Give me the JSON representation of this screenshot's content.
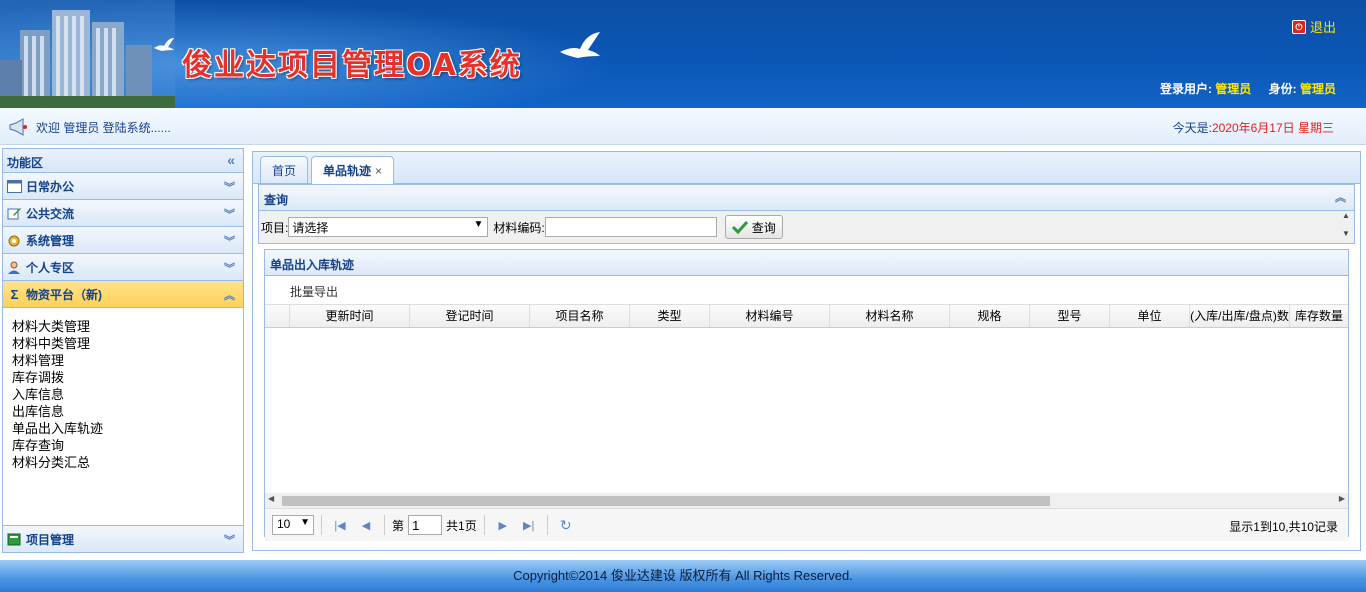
{
  "header": {
    "title": "俊业达项目管理OA系统",
    "logout_label": "退出",
    "user_label": "登录用户:",
    "user_value": "管理员",
    "role_label": "身份:",
    "role_value": "管理员"
  },
  "welcome": {
    "message": "欢迎 管理员 登陆系统......",
    "today_label": "今天是:",
    "date": "2020年6月17日 星期三"
  },
  "sidebar": {
    "title": "功能区",
    "sections": [
      {
        "label": "日常办公",
        "icon": "calendar-icon"
      },
      {
        "label": "公共交流",
        "icon": "edit-icon"
      },
      {
        "label": "系统管理",
        "icon": "gear-icon"
      },
      {
        "label": "个人专区",
        "icon": "user-icon"
      },
      {
        "label": "物资平台（新)",
        "icon": "sigma-icon"
      }
    ],
    "menu_items": [
      "材料大类管理",
      "材料中类管理",
      "材料管理",
      "库存调拨",
      "入库信息",
      "出库信息",
      "单品出入库轨迹",
      "库存查询",
      "材料分类汇总"
    ],
    "bottom_section": {
      "label": "项目管理",
      "icon": "book-icon"
    }
  },
  "tabs": [
    {
      "label": "首页"
    },
    {
      "label": "单品轨迹",
      "close": "×"
    }
  ],
  "query": {
    "title": "查询",
    "project_label": "项目:",
    "project_value": "请选择",
    "code_label": "材料编码:",
    "code_value": "",
    "button_label": "查询"
  },
  "grid": {
    "title": "单品出入库轨迹",
    "toolbar_label": "批量导出",
    "columns": [
      "更新时间",
      "登记时间",
      "项目名称",
      "类型",
      "材料编号",
      "材料名称",
      "规格",
      "型号",
      "单位",
      "(入库/出库/盘点)数",
      "库存数量"
    ],
    "rows": []
  },
  "pager": {
    "page_size": "10",
    "page_label": "第",
    "page_value": "1",
    "total_label": "共1页",
    "info": "显示1到10,共10记录"
  },
  "footer": {
    "copyright": "Copyright©2014 俊业达建设 版权所有 All Rights Reserved."
  }
}
